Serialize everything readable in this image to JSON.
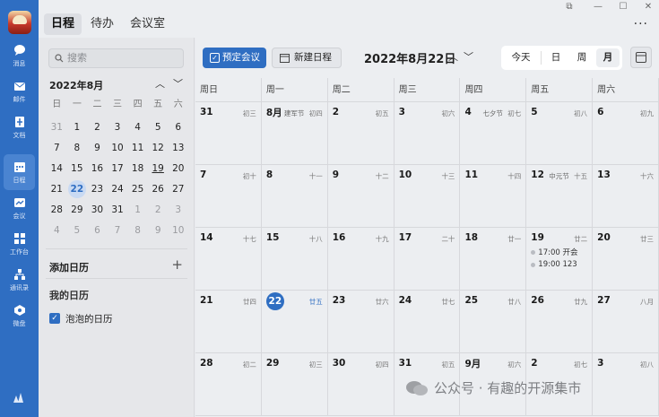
{
  "rail": {
    "items": [
      {
        "label": "消息",
        "icon": "chat-icon"
      },
      {
        "label": "邮件",
        "icon": "mail-icon"
      },
      {
        "label": "文档",
        "icon": "document-icon"
      },
      {
        "label": "日程",
        "icon": "calendar-icon"
      },
      {
        "label": "会议",
        "icon": "meeting-icon"
      },
      {
        "label": "工作台",
        "icon": "workbench-icon"
      },
      {
        "label": "通讯录",
        "icon": "contacts-icon"
      },
      {
        "label": "微盘",
        "icon": "drive-icon"
      }
    ],
    "active_index": 3
  },
  "topbar": {
    "tabs": [
      "日程",
      "待办",
      "会议室"
    ],
    "active_tab": 0
  },
  "side": {
    "search_placeholder": "搜索",
    "mini_title": "2022年8月",
    "weekdays": [
      "日",
      "一",
      "二",
      "三",
      "四",
      "五",
      "六"
    ],
    "weeks": [
      [
        "31",
        "1",
        "2",
        "3",
        "4",
        "5",
        "6"
      ],
      [
        "7",
        "8",
        "9",
        "10",
        "11",
        "12",
        "13"
      ],
      [
        "14",
        "15",
        "16",
        "17",
        "18",
        "19",
        "20"
      ],
      [
        "21",
        "22",
        "23",
        "24",
        "25",
        "26",
        "27"
      ],
      [
        "28",
        "29",
        "30",
        "31",
        "1",
        "2",
        "3"
      ],
      [
        "4",
        "5",
        "6",
        "7",
        "8",
        "9",
        "10"
      ]
    ],
    "add_calendar": "添加日历",
    "my_calendars_label": "我的日历",
    "calendar_name": "泡泡的日历"
  },
  "main": {
    "book_meeting": "预定会议",
    "new_event": "新建日程",
    "current_date": "2022年8月22日",
    "view_today": "今天",
    "views": [
      "日",
      "周",
      "月"
    ],
    "active_view": 2,
    "weekday_headers": [
      "周日",
      "周一",
      "周二",
      "周三",
      "周四",
      "周五",
      "周六"
    ]
  },
  "month": [
    [
      {
        "num": "31",
        "lunar": "初三"
      },
      {
        "num": "8月",
        "lunar": "初四",
        "festival": "建军节"
      },
      {
        "num": "2",
        "lunar": "初五"
      },
      {
        "num": "3",
        "lunar": "初六"
      },
      {
        "num": "4",
        "lunar": "初七",
        "festival": "七夕节"
      },
      {
        "num": "5",
        "lunar": "初八"
      },
      {
        "num": "6",
        "lunar": "初九"
      }
    ],
    [
      {
        "num": "7",
        "lunar": "初十"
      },
      {
        "num": "8",
        "lunar": "十一"
      },
      {
        "num": "9",
        "lunar": "十二"
      },
      {
        "num": "10",
        "lunar": "十三"
      },
      {
        "num": "11",
        "lunar": "十四"
      },
      {
        "num": "12",
        "lunar": "十五",
        "festival": "中元节"
      },
      {
        "num": "13",
        "lunar": "十六"
      }
    ],
    [
      {
        "num": "14",
        "lunar": "十七"
      },
      {
        "num": "15",
        "lunar": "十八"
      },
      {
        "num": "16",
        "lunar": "十九"
      },
      {
        "num": "17",
        "lunar": "二十"
      },
      {
        "num": "18",
        "lunar": "廿一"
      },
      {
        "num": "19",
        "lunar": "廿二",
        "events": [
          "17:00 开会",
          "19:00 123"
        ]
      },
      {
        "num": "20",
        "lunar": "廿三"
      }
    ],
    [
      {
        "num": "21",
        "lunar": "廿四"
      },
      {
        "num": "22",
        "lunar": "廿五",
        "today": true
      },
      {
        "num": "23",
        "lunar": "廿六"
      },
      {
        "num": "24",
        "lunar": "廿七"
      },
      {
        "num": "25",
        "lunar": "廿八"
      },
      {
        "num": "26",
        "lunar": "廿九"
      },
      {
        "num": "27",
        "lunar": "八月"
      }
    ],
    [
      {
        "num": "28",
        "lunar": "初二"
      },
      {
        "num": "29",
        "lunar": "初三"
      },
      {
        "num": "30",
        "lunar": "初四"
      },
      {
        "num": "31",
        "lunar": "初五"
      },
      {
        "num": "9月",
        "lunar": "初六"
      },
      {
        "num": "2",
        "lunar": "初七"
      },
      {
        "num": "3",
        "lunar": "初八"
      }
    ]
  ],
  "watermark": "公众号 · 有趣的开源集市",
  "colors": {
    "accent": "#2f6ec2",
    "rail": "#2f6ec2"
  }
}
